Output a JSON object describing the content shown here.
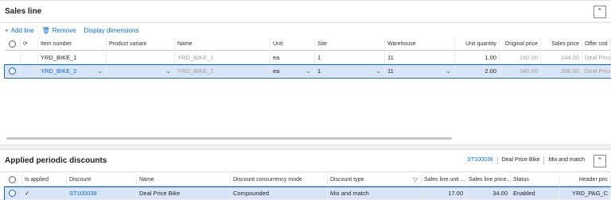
{
  "sales": {
    "title": "Sales line",
    "toolbar": {
      "add": "Add line",
      "remove": "Remove",
      "dims": "Display dimensions"
    },
    "columns": [
      "Item number",
      "Product variant",
      "Name",
      "Unit",
      "Site",
      "Warehouse",
      "Unit quantity",
      "Original price",
      "Sales price",
      "Offer cod"
    ],
    "rows": [
      [
        "YRD_BIKE_1",
        "",
        "YRD_BIKE_1",
        "ea",
        "1",
        "11",
        "1.00",
        "160.00",
        "144.00",
        "Deal Price"
      ],
      [
        "YRD_BIKE_2",
        "",
        "YRD_BIKE_2",
        "ea",
        "1",
        "11",
        "2.00",
        "340.00",
        "306.00",
        "Deal Price"
      ]
    ]
  },
  "discounts": {
    "title": "Applied periodic discounts",
    "pills": [
      "ST100038",
      "Deal Price Bike",
      "Mix and match"
    ],
    "columns": [
      "Is applied",
      "Discount",
      "Name",
      "Discount concurrency mode",
      "Discount type",
      "Sales line unit ...",
      "Sales line price...",
      "Status",
      "Header pric"
    ],
    "rows": [
      [
        "✓",
        "ST100038",
        "Deal Price Bike",
        "Compounded",
        "Mix and match",
        "17.00",
        "34.00",
        "Enabled",
        "YRD_PAG_C"
      ]
    ]
  },
  "icons": {
    "add": "plus-icon",
    "remove": "trash-icon",
    "refresh": "refresh-icon",
    "collapse": "chevron-up-icon",
    "filter": "filter-icon"
  },
  "colors": {
    "accent": "#0f6cbd",
    "selected_row": "#d8e4f8"
  }
}
